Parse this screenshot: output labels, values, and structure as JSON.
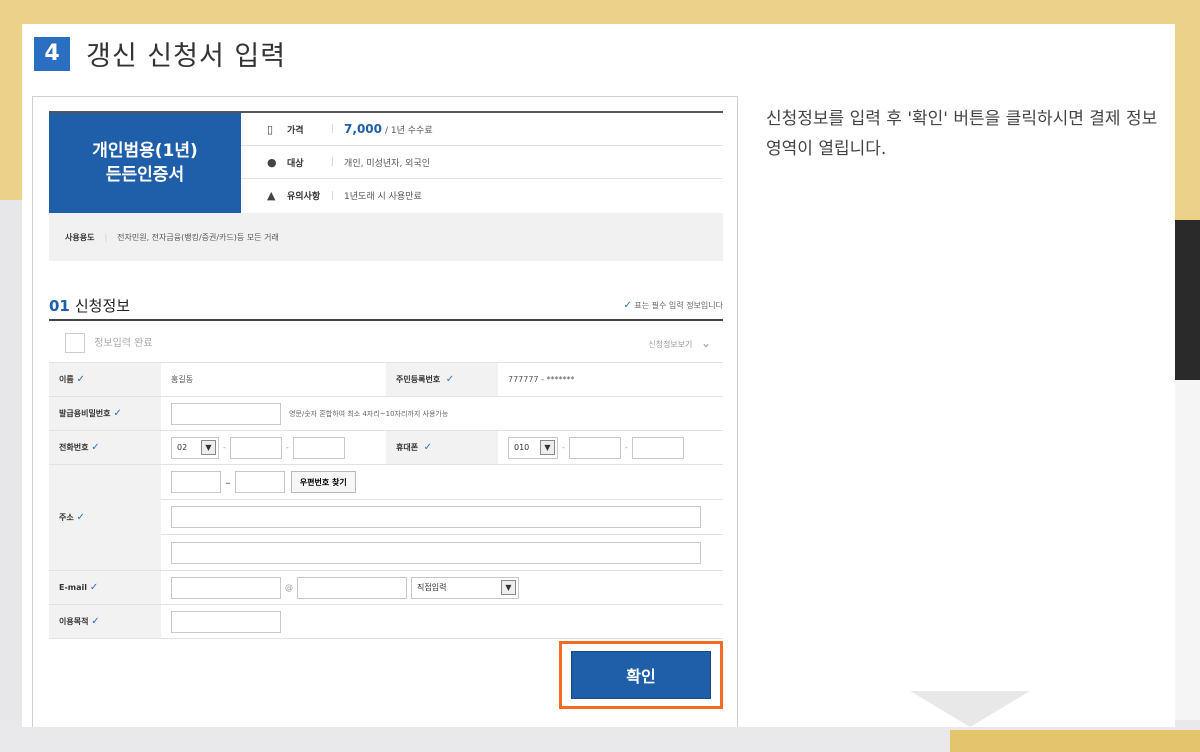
{
  "step": {
    "number": "4",
    "title": "갱신 신청서 입력"
  },
  "description": "신청정보를 입력 후 '확인' 버튼을 클릭하시면 결제 정보 영역이 열립니다.",
  "product": {
    "name_line1": "개인범용(1년)",
    "name_line2": "든든인증서",
    "price_label": "가격",
    "price_value": "7,000",
    "price_unit": "/ 1년 수수료",
    "target_label": "대상",
    "target_value": "개인, 미성년자, 외국인",
    "notice_label": "유의사항",
    "notice_value": "1년도래 시 사용만료",
    "usage_label": "사용용도",
    "usage_value": "전자민원, 전자금융(뱅킹/증권/카드)등 모든 거래"
  },
  "section": {
    "number": "01",
    "title": "신청정보",
    "required_note": "표는 필수 입력 정보입니다",
    "complete_label": "정보입력 완료",
    "view_more": "신청정보보기"
  },
  "form": {
    "name_label": "이름",
    "name_value": "홍길동",
    "rrn_label": "주민등록번호",
    "rrn_value": "777777 - *******",
    "password_label": "발급용비밀번호",
    "password_hint": "영문/숫자 혼합하여 최소 4자리~10자리까지 사용가능",
    "phone_label": "전화번호",
    "phone_area": "02",
    "mobile_label": "휴대폰",
    "mobile_prefix": "010",
    "address_label": "주소",
    "zip_button": "우편번호 찾기",
    "email_label": "E-mail",
    "email_at": "@",
    "email_domain_select": "직접입력",
    "purpose_label": "이용목적"
  },
  "confirm_button": "확인",
  "colors": {
    "primary": "#1f5ea8",
    "highlight": "#f46b22",
    "step_badge": "#2b6fc2"
  }
}
